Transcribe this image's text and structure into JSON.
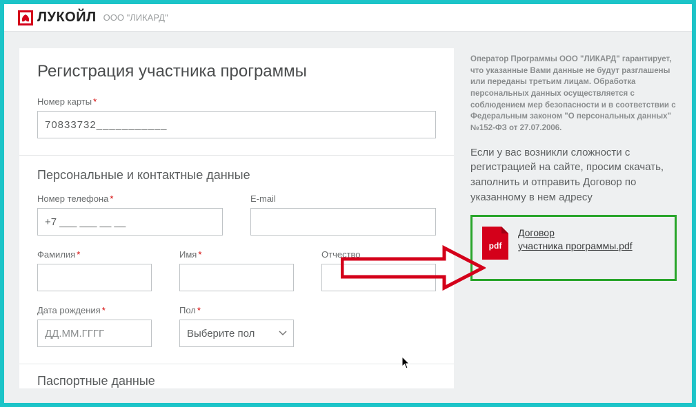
{
  "header": {
    "brand": "ЛУКОЙЛ",
    "company": "ООО \"ЛИКАРД\""
  },
  "page_title": "Регистрация участника программы",
  "card": {
    "label": "Номер карты",
    "value": "70833732___________"
  },
  "sections": {
    "personal_title": "Персональные и контактные данные",
    "passport_title": "Паспортные данные"
  },
  "fields": {
    "phone_label": "Номер телефона",
    "phone_value": "+7 ___ ___ __ __",
    "email_label": "E-mail",
    "lastname_label": "Фамилия",
    "firstname_label": "Имя",
    "midname_label": "Отчество",
    "dob_label": "Дата рождения",
    "dob_placeholder": "ДД.ММ.ГГГГ",
    "gender_label": "Пол",
    "gender_placeholder": "Выберите пол"
  },
  "sidebar": {
    "notice": "Оператор Программы ООО \"ЛИКАРД\" гарантирует, что указанные Вами данные не будут разглашены или переданы третьим лицам. Обработка персональных данных осуществляется с соблюдением мер безопасности и в соответствии с Федеральным законом \"О персональных данных\" №152-ФЗ от 27.07.2006.",
    "help": "Если у вас возникли сложности с регистрацией на сайте, просим скачать, заполнить и отправить Договор по указанному в нем адресу",
    "pdf_badge": "pdf",
    "download_line1": "Договор",
    "download_line2": "участника программы.pdf"
  }
}
